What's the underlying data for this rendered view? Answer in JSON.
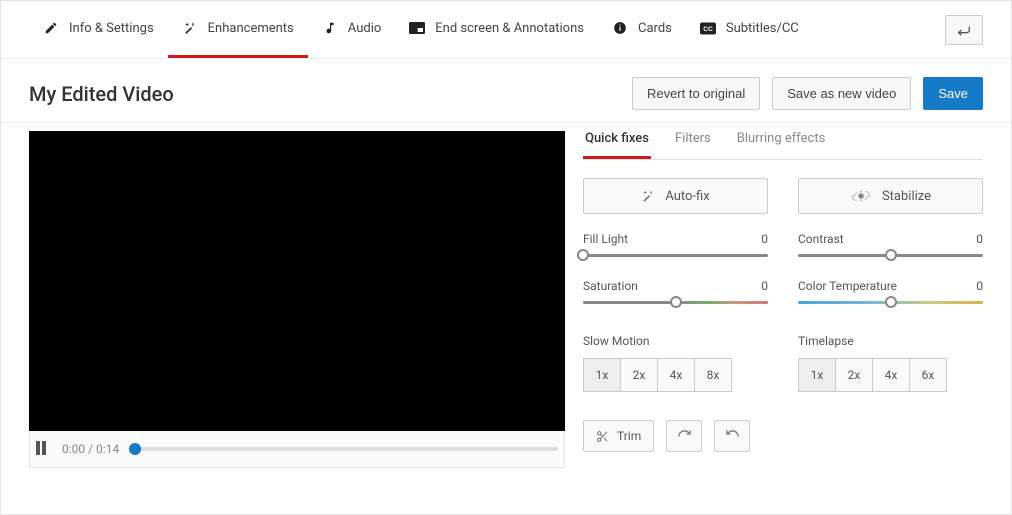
{
  "tabs": {
    "info": "Info & Settings",
    "enhancements": "Enhancements",
    "audio": "Audio",
    "endscreen": "End screen & Annotations",
    "cards": "Cards",
    "subtitles": "Subtitles/CC"
  },
  "title": "My Edited Video",
  "header_actions": {
    "revert": "Revert to original",
    "save_new": "Save as new video",
    "save": "Save"
  },
  "player": {
    "time": "0:00 / 0:14"
  },
  "subtabs": {
    "quickfixes": "Quick fixes",
    "filters": "Filters",
    "blurring": "Blurring effects"
  },
  "fix_buttons": {
    "autofix": "Auto-fix",
    "stabilize": "Stabilize"
  },
  "sliders": {
    "fill_light": {
      "label": "Fill Light",
      "value": "0",
      "thumb_pct": 0
    },
    "contrast": {
      "label": "Contrast",
      "value": "0",
      "thumb_pct": 50
    },
    "saturation": {
      "label": "Saturation",
      "value": "0",
      "thumb_pct": 50
    },
    "color_temp": {
      "label": "Color Temperature",
      "value": "0",
      "thumb_pct": 50
    }
  },
  "slowmotion": {
    "label": "Slow Motion",
    "options": [
      "1x",
      "2x",
      "4x",
      "8x"
    ],
    "active": "1x"
  },
  "timelapse": {
    "label": "Timelapse",
    "options": [
      "1x",
      "2x",
      "4x",
      "6x"
    ],
    "active": "1x"
  },
  "bottom": {
    "trim": "Trim"
  }
}
